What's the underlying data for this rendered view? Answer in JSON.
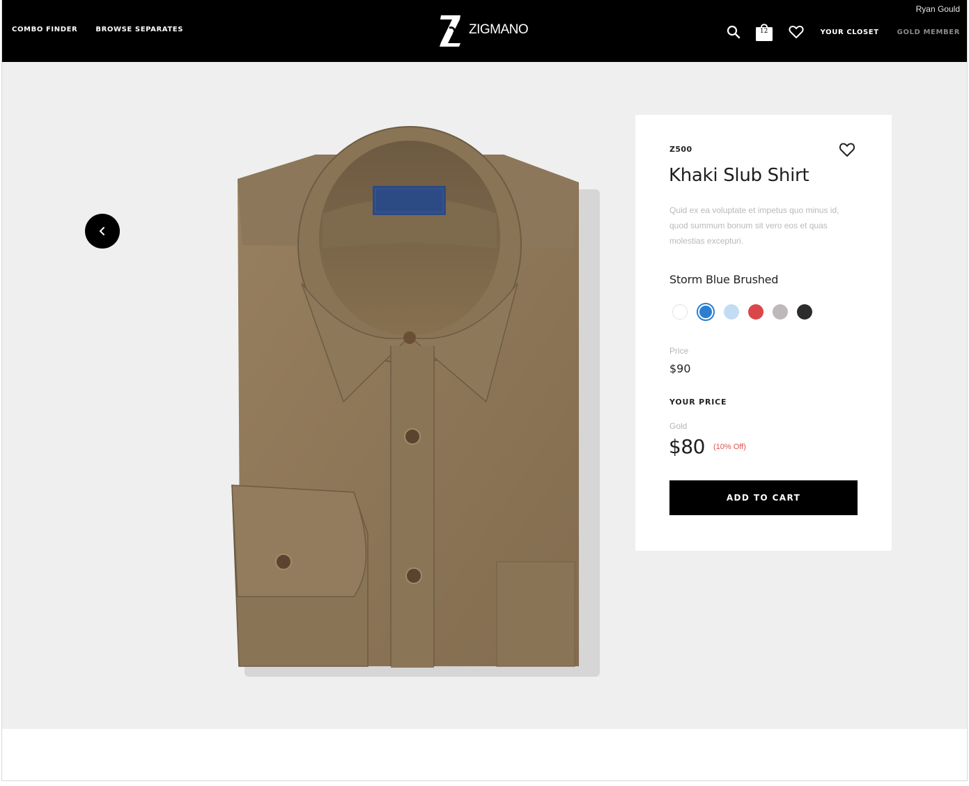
{
  "header": {
    "nav_left": [
      "COMBO FINDER",
      "BROWSE SEPARATES"
    ],
    "logo_text": "ZIGMANO",
    "user_name": "Ryan Gould",
    "cart_count": "12",
    "closet_label": "YOUR CLOSET",
    "member_label": "GOLD MEMBER",
    "icons": [
      "search-icon",
      "shopping-bag-icon",
      "heart-icon"
    ]
  },
  "gallery": {
    "prev_icon": "chevron-left-icon"
  },
  "product": {
    "sku": "Z500",
    "title": "Khaki Slub Shirt",
    "description": "Quid ex ea voluptate et impetus quo minus id, quod summum bonum sit vero eos et quas molestias excepturi.",
    "color_name": "Storm Blue Brushed",
    "swatches": [
      {
        "name": "white",
        "color": "#ffffff"
      },
      {
        "name": "storm-blue",
        "color": "#2a7fd1",
        "selected": true
      },
      {
        "name": "light-blue",
        "color": "#c3dcf3"
      },
      {
        "name": "red",
        "color": "#d9474a"
      },
      {
        "name": "gray",
        "color": "#bfb8ba"
      },
      {
        "name": "charcoal",
        "color": "#2c2c2c"
      }
    ],
    "price_label": "Price",
    "price": "$90",
    "your_price_label": "YOUR PRICE",
    "tier_label": "Gold",
    "sale_price": "$80",
    "discount": "(10% Off)",
    "cta_label": "ADD TO CART"
  },
  "colors": {
    "header_bg": "#000000",
    "hero_bg": "#efefef",
    "accent_blue": "#2a7fd1",
    "discount_red": "#e0504a",
    "shirt_khaki": "#8c7658"
  }
}
